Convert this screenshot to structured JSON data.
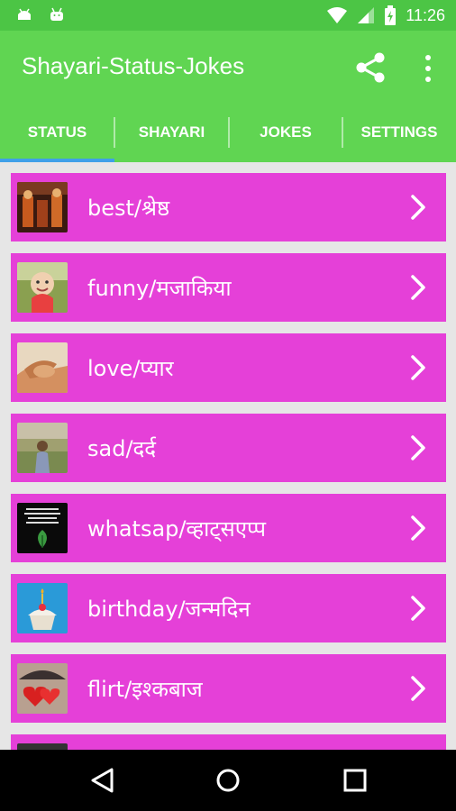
{
  "status_bar": {
    "time": "11:26",
    "icons": [
      "android-notification-icon",
      "android-notification-icon",
      "wifi-icon",
      "signal-icon",
      "battery-icon"
    ]
  },
  "app_bar": {
    "title": "Shayari-Status-Jokes",
    "icons": [
      "share-icon",
      "more-vert-icon"
    ]
  },
  "tabs": [
    {
      "label": "STATUS",
      "selected": true
    },
    {
      "label": "SHAYARI",
      "selected": false
    },
    {
      "label": "JOKES",
      "selected": false
    },
    {
      "label": "SETTINGS",
      "selected": false
    }
  ],
  "list": {
    "items": [
      {
        "label": "best/श्रेष्ठ",
        "thumb": "best-thumbnail"
      },
      {
        "label": "funny/मजाकिया",
        "thumb": "funny-thumbnail"
      },
      {
        "label": "love/प्यार",
        "thumb": "love-thumbnail"
      },
      {
        "label": "sad/दर्द",
        "thumb": "sad-thumbnail"
      },
      {
        "label": "whatsap/व्हाट्सएप्प",
        "thumb": "whatsapp-thumbnail"
      },
      {
        "label": "birthday/जन्मदिन",
        "thumb": "birthday-thumbnail"
      },
      {
        "label": "flirt/इश्कबाज",
        "thumb": "flirt-thumbnail"
      }
    ]
  },
  "nav_bar": {
    "icons": [
      "back-icon",
      "home-icon",
      "recents-icon"
    ]
  },
  "colors": {
    "status_bar": "#4cc545",
    "app_bar": "#60d552",
    "list_item": "#e540d8",
    "tab_indicator": "#3fa0e8",
    "background": "#e6e6e6"
  }
}
